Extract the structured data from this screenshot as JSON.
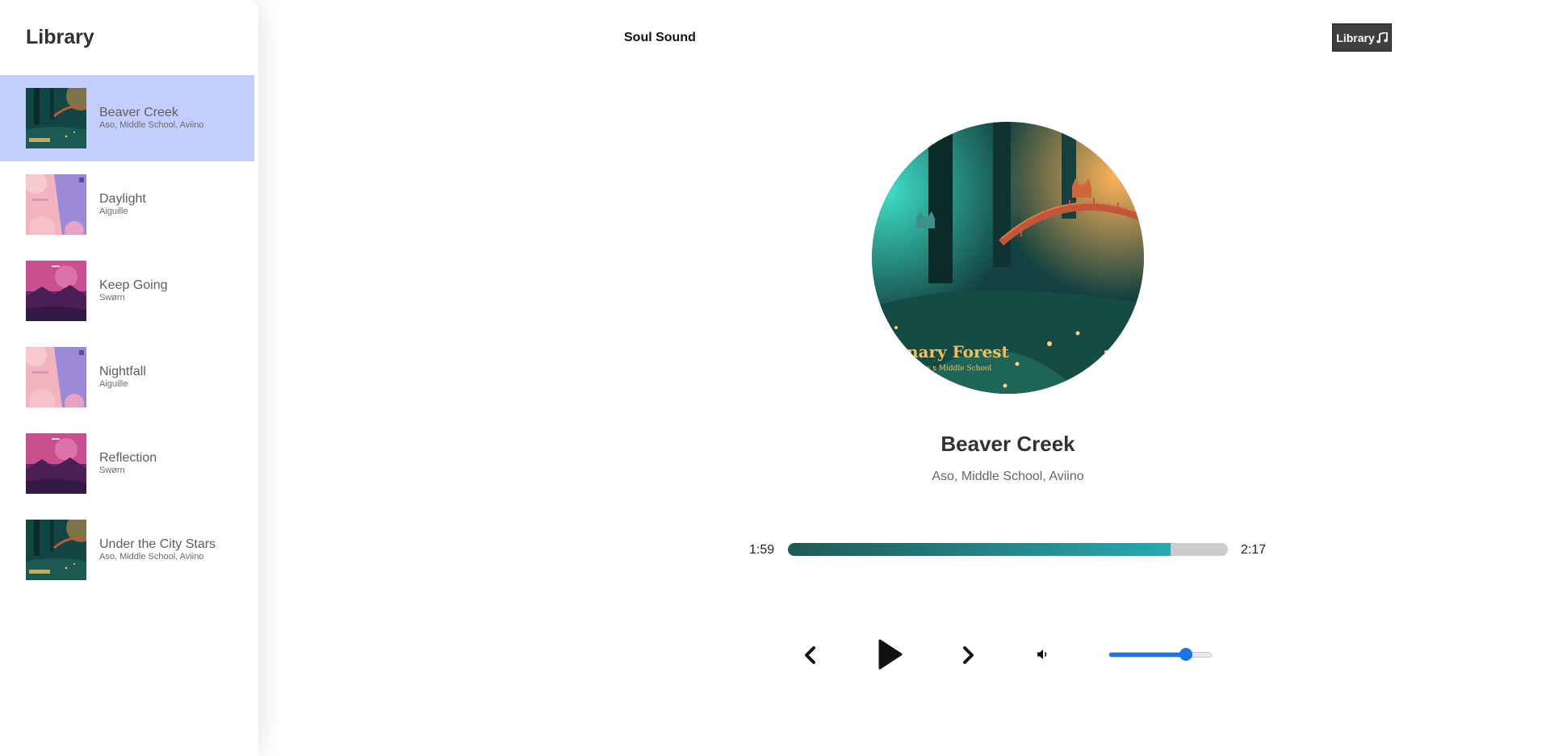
{
  "sidebar": {
    "title": "Library",
    "songs": [
      {
        "name": "Beaver Creek",
        "artist": "Aso, Middle School, Aviino",
        "art": "forest",
        "active": true
      },
      {
        "name": "Daylight",
        "artist": "Aiguille",
        "art": "pink-sky",
        "active": false
      },
      {
        "name": "Keep Going",
        "artist": "Swørn",
        "art": "magenta-dusk",
        "active": false
      },
      {
        "name": "Nightfall",
        "artist": "Aiguille",
        "art": "pink-sky",
        "active": false
      },
      {
        "name": "Reflection",
        "artist": "Swørn",
        "art": "magenta-dusk",
        "active": false
      },
      {
        "name": "Under the City Stars",
        "artist": "Aso, Middle School, Aviino",
        "art": "forest",
        "active": false
      }
    ]
  },
  "header": {
    "app_name": "Soul Sound",
    "library_button": "Library",
    "library_icon": "music-note-icon"
  },
  "player": {
    "title": "Beaver Creek",
    "artist": "Aso, Middle School, Aviino",
    "album_art_text": "anary Forest",
    "album_art_subtext": "iino x Middle School",
    "current_time": "1:59",
    "total_time": "2:17",
    "progress_fraction": 0.87,
    "volume_fraction": 0.75,
    "icons": {
      "prev": "chevron-left-icon",
      "play": "play-icon",
      "next": "chevron-right-icon",
      "volume": "speaker-icon"
    }
  },
  "colors": {
    "active_song_bg": "#c3cefd",
    "progress_start": "#1f5a55",
    "progress_end": "#2aa8b0",
    "volume_accent": "#1a73e8",
    "library_button_bg": "#3f3f3f"
  }
}
